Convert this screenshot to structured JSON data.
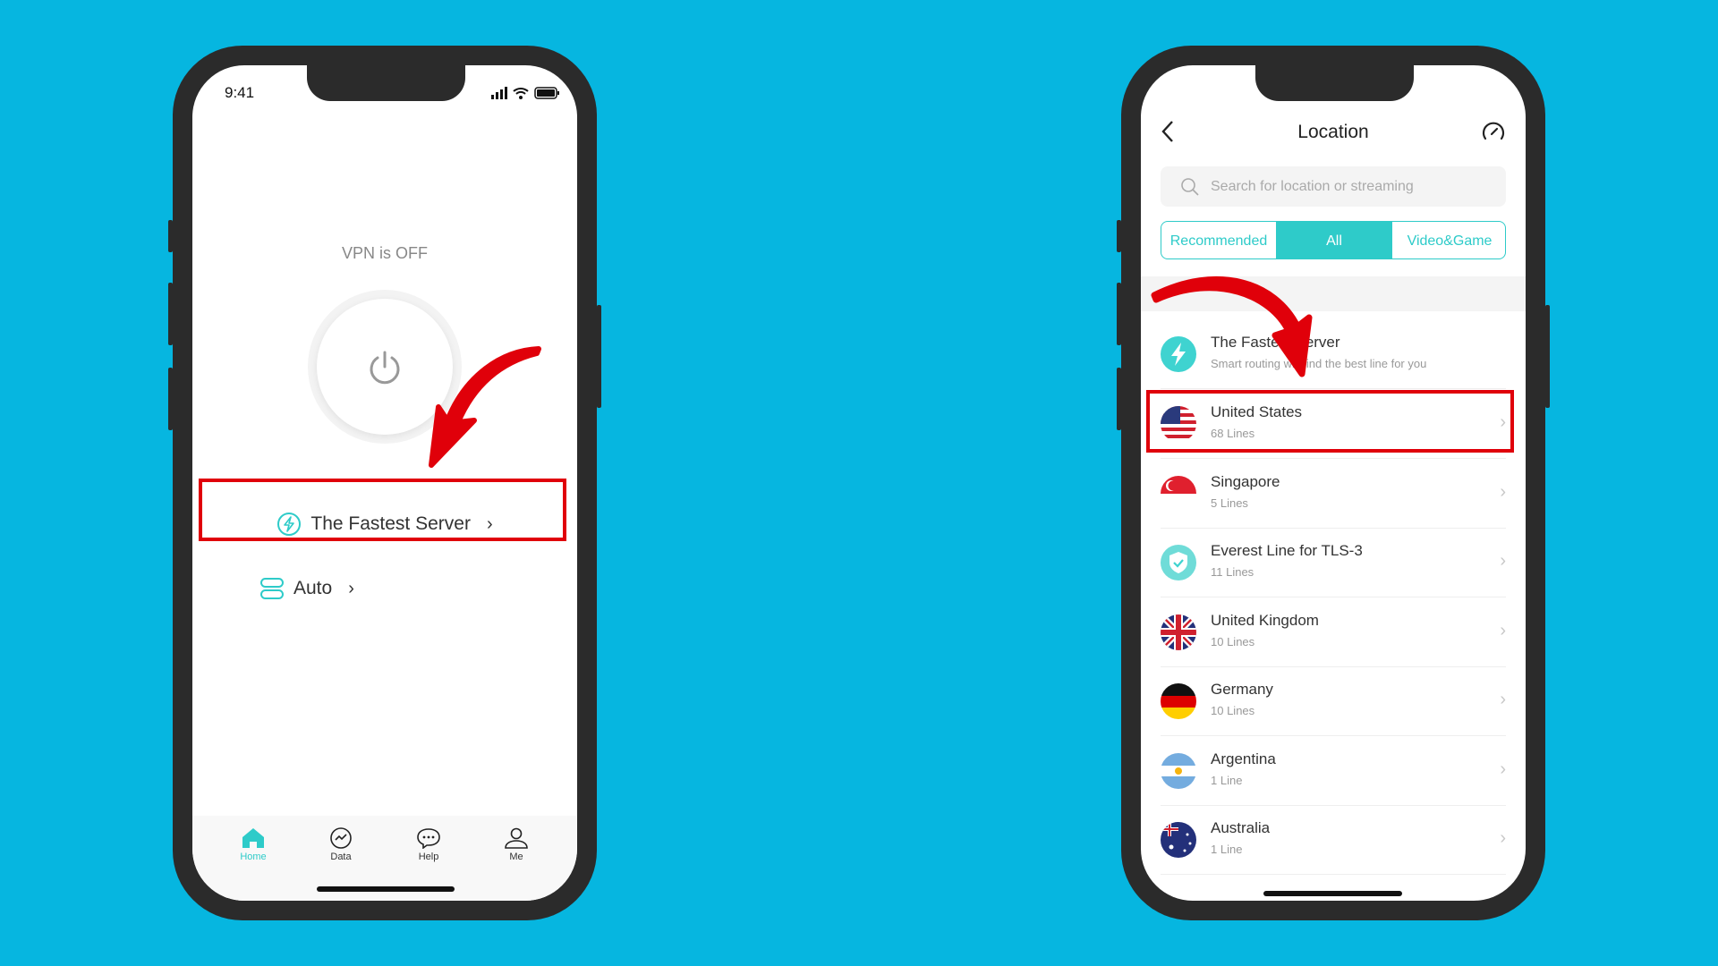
{
  "colors": {
    "background": "#06b6e0",
    "accent": "#2ecbc9",
    "highlight": "#e0000a"
  },
  "home": {
    "status_time": "9:41",
    "vpn_status": "VPN is OFF",
    "fastest_server_label": "The Fastest Server",
    "auto_label": "Auto",
    "nav": [
      {
        "label": "Home",
        "icon": "home-icon",
        "active": true
      },
      {
        "label": "Data",
        "icon": "chart-icon"
      },
      {
        "label": "Help",
        "icon": "chat-bubble-icon"
      },
      {
        "label": "Me",
        "icon": "user-icon"
      }
    ]
  },
  "location": {
    "title": "Location",
    "search_placeholder": "Search for location or streaming",
    "tabs": [
      {
        "label": "Recommended"
      },
      {
        "label": "All",
        "active": true
      },
      {
        "label": "Video&Game"
      }
    ],
    "items": [
      {
        "title": "The Fastest Server",
        "subtitle": "Smart routing will find the best line for you",
        "icon": "lightning-icon"
      },
      {
        "title": "United States",
        "subtitle": "68 Lines",
        "icon": "flag-us-icon",
        "highlighted": true
      },
      {
        "title": "Singapore",
        "subtitle": "5 Lines",
        "icon": "flag-sg-icon"
      },
      {
        "title": "Everest Line for TLS-3",
        "subtitle": "11 Lines",
        "icon": "shield-icon"
      },
      {
        "title": "United Kingdom",
        "subtitle": "10 Lines",
        "icon": "flag-uk-icon"
      },
      {
        "title": "Germany",
        "subtitle": "10 Lines",
        "icon": "flag-de-icon"
      },
      {
        "title": "Argentina",
        "subtitle": "1 Line",
        "icon": "flag-ar-icon"
      },
      {
        "title": "Australia",
        "subtitle": "1 Line",
        "icon": "flag-au-icon"
      }
    ]
  }
}
